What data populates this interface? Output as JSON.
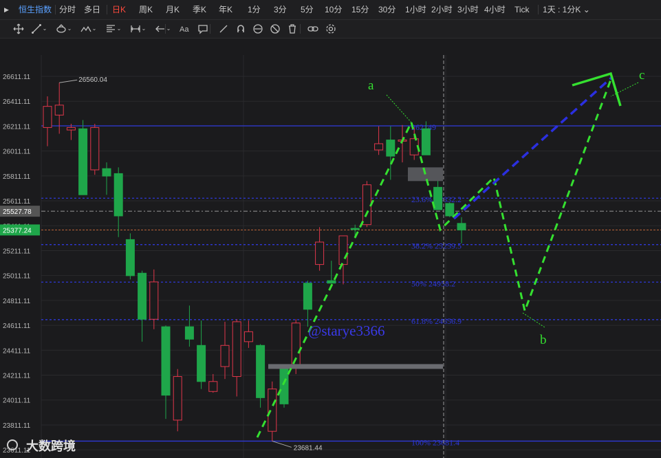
{
  "toolbar": {
    "symbol": "恒生指数",
    "periods": [
      "分时",
      "多日",
      "日K",
      "周K",
      "月K",
      "季K",
      "年K",
      "1分",
      "3分",
      "5分",
      "10分",
      "15分",
      "30分",
      "1小时",
      "2小时",
      "3小时",
      "4小时",
      "Tick"
    ],
    "active_period": "日K",
    "layout_label": "1天 : 1分K",
    "tools": [
      "crosshair-icon",
      "trendline-icon",
      "brush-icon",
      "wave-icon",
      "indicator-icon",
      "measure-icon",
      "arrow-icon",
      "text-icon",
      "comment-icon",
      "pen-icon",
      "magnet-icon",
      "visibility-icon",
      "hide-icon",
      "delete-icon",
      "link-icon",
      "settings-icon"
    ]
  },
  "colors": {
    "up": "#e0374b",
    "down": "#1fa64a",
    "fib": "#2e38d8",
    "wave": "#35e030",
    "accent": "#ff4a3d"
  },
  "chart_data": {
    "type": "candlestick",
    "ylim": [
      23681.44,
      26700
    ],
    "y_ticks": [
      "26611.11",
      "26411.11",
      "26211.11",
      "26011.11",
      "25811.11",
      "25611.11",
      "25411.11",
      "25211.11",
      "25011.11",
      "24811.11",
      "24611.11",
      "24411.11",
      "24211.11",
      "24011.11",
      "23811.11",
      "23611.11"
    ],
    "price_tags": [
      {
        "label": "25527.78",
        "value": 25527.78,
        "color": "#555555"
      },
      {
        "label": "25377.24",
        "value": 25377.24,
        "color": "#1fa64a"
      }
    ],
    "high_label": {
      "text": "26560.04",
      "value": 26560.04
    },
    "low_label": {
      "text": "23681.44",
      "value": 23681.44
    },
    "candles": [
      {
        "o": 26200,
        "h": 26450,
        "l": 26050,
        "c": 26370
      },
      {
        "o": 26300,
        "h": 26560.04,
        "l": 26150,
        "c": 26380
      },
      {
        "o": 26180,
        "h": 26230,
        "l": 26100,
        "c": 26200
      },
      {
        "o": 26190,
        "h": 26260,
        "l": 25800,
        "c": 25660
      },
      {
        "o": 25860,
        "h": 26230,
        "l": 25820,
        "c": 26200
      },
      {
        "o": 25870,
        "h": 25920,
        "l": 25660,
        "c": 25810
      },
      {
        "o": 25830,
        "h": 25880,
        "l": 25320,
        "c": 25490
      },
      {
        "o": 25300,
        "h": 25350,
        "l": 24980,
        "c": 25010
      },
      {
        "o": 25030,
        "h": 25050,
        "l": 24480,
        "c": 24660
      },
      {
        "o": 24660,
        "h": 25060,
        "l": 24580,
        "c": 24960
      },
      {
        "o": 24600,
        "h": 24610,
        "l": 23860,
        "c": 24050
      },
      {
        "o": 23850,
        "h": 24260,
        "l": 23760,
        "c": 24200
      },
      {
        "o": 24600,
        "h": 24770,
        "l": 24440,
        "c": 24500
      },
      {
        "o": 24450,
        "h": 24650,
        "l": 24100,
        "c": 24160
      },
      {
        "o": 24080,
        "h": 24220,
        "l": 24070,
        "c": 24160
      },
      {
        "o": 24280,
        "h": 24640,
        "l": 24180,
        "c": 24450
      },
      {
        "o": 24200,
        "h": 24660,
        "l": 24040,
        "c": 24640
      },
      {
        "o": 24480,
        "h": 24650,
        "l": 24430,
        "c": 24560
      },
      {
        "o": 24450,
        "h": 24460,
        "l": 23950,
        "c": 24030
      },
      {
        "o": 23760,
        "h": 24160,
        "l": 23681.44,
        "c": 24100
      },
      {
        "o": 24270,
        "h": 24280,
        "l": 23950,
        "c": 23980
      },
      {
        "o": 24270,
        "h": 24660,
        "l": 24220,
        "c": 24630
      },
      {
        "o": 24950,
        "h": 24970,
        "l": 24600,
        "c": 24740
      },
      {
        "o": 25100,
        "h": 25400,
        "l": 25050,
        "c": 25280
      },
      {
        "o": 24970,
        "h": 25130,
        "l": 24950,
        "c": 24950
      },
      {
        "o": 25100,
        "h": 25280,
        "l": 24940,
        "c": 25330
      },
      {
        "o": 25390,
        "h": 25420,
        "l": 25310,
        "c": 25380
      },
      {
        "o": 25420,
        "h": 25770,
        "l": 25400,
        "c": 25740
      },
      {
        "o": 26020,
        "h": 26210,
        "l": 25980,
        "c": 26070
      },
      {
        "o": 26100,
        "h": 26210,
        "l": 25780,
        "c": 25970
      },
      {
        "o": 26090,
        "h": 26220,
        "l": 25920,
        "c": 26100
      },
      {
        "o": 25980,
        "h": 26200,
        "l": 25940,
        "c": 26110
      },
      {
        "o": 26190,
        "h": 26250,
        "l": 26000,
        "c": 25980
      },
      {
        "o": 25720,
        "h": 25790,
        "l": 25540,
        "c": 25540
      },
      {
        "o": 25590,
        "h": 25600,
        "l": 25480,
        "c": 25490
      },
      {
        "o": 25430,
        "h": 25480,
        "l": 25270,
        "c": 25377.24
      }
    ],
    "fib_levels": [
      {
        "value": 26213.49,
        "label": "262149",
        "style": "solid"
      },
      {
        "value": 25632.2,
        "label": "23.6% 25632.2",
        "style": "dash"
      },
      {
        "value": 25259.5,
        "label": "38.2% 25259.5",
        "style": "dash"
      },
      {
        "value": 24958.2,
        "label": "50% 24958.2",
        "style": "dash"
      },
      {
        "value": 24656.9,
        "label": "61.8% 24656.9",
        "style": "dash"
      },
      {
        "value": 23681.4,
        "label": "100% 23681.4",
        "style": "solid"
      }
    ],
    "wave_labels": [
      "a",
      "b",
      "c"
    ],
    "watermark": "@starye3366",
    "current_price_line": 25527.78,
    "last_price_line": 25377.24
  },
  "footer_watermark": "大数跨境"
}
